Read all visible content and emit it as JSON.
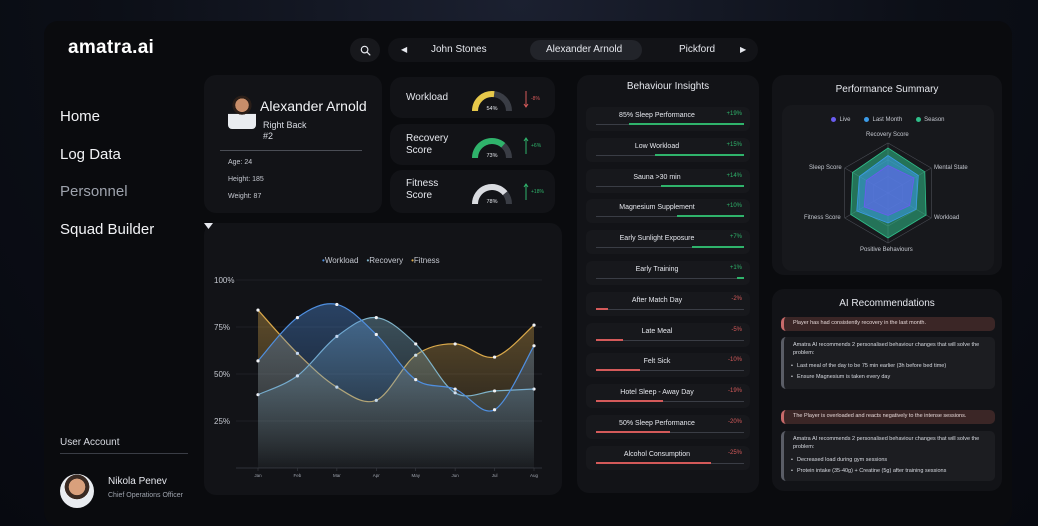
{
  "app": {
    "logo": "amatra.ai"
  },
  "nav": {
    "items": [
      "Home",
      "Log Data",
      "Personnel",
      "Squad Builder"
    ]
  },
  "user": {
    "section_label": "User Account",
    "name": "Nikola Penev",
    "role": "Chief Operations Officer"
  },
  "topbar": {
    "search_icon": "search-icon",
    "players": {
      "prev": "John Stones",
      "current": "Alexander Arnold",
      "next": "Pickford"
    }
  },
  "profile": {
    "name": "Alexander Arnold",
    "position": "Right Back",
    "number": "#2",
    "age": "Age: 24",
    "height": "Height: 185",
    "weight": "Weight: 87"
  },
  "metrics": [
    {
      "label": "Workload",
      "value": "54%",
      "fraction": 0.54,
      "color": "#e6c84a",
      "delta": "-8%",
      "delta_color": "#d45a5a",
      "direction": "down"
    },
    {
      "label": "Recovery Score",
      "value": "73%",
      "fraction": 0.73,
      "color": "#2fb36b",
      "delta": "+6%",
      "delta_color": "#2fb36b",
      "direction": "up"
    },
    {
      "label": "Fitness Score",
      "value": "78%",
      "fraction": 0.78,
      "color": "#d9dbe0",
      "delta": "+18%",
      "delta_color": "#2fb36b",
      "direction": "up"
    }
  ],
  "chart_data": {
    "type": "area",
    "legend": [
      "Workload",
      "Recovery",
      "Fitness"
    ],
    "categories": [
      "Jan",
      "Feb",
      "Mar",
      "Apr",
      "May",
      "Jun",
      "Jul",
      "Aug"
    ],
    "y_ticks": [
      "100%",
      "75%",
      "50%",
      "25%"
    ],
    "ylim": [
      0,
      100
    ],
    "series": [
      {
        "name": "Workload",
        "color": "#4f8fe0",
        "values": [
          57,
          80,
          87,
          71,
          47,
          42,
          31,
          65
        ]
      },
      {
        "name": "Recovery",
        "color": "#7fb3c9",
        "values": [
          39,
          49,
          70,
          80,
          66,
          40,
          41,
          42
        ]
      },
      {
        "name": "Fitness",
        "color": "#d9a84a",
        "values": [
          84,
          61,
          43,
          36,
          60,
          66,
          59,
          76
        ]
      }
    ]
  },
  "behaviour": {
    "title": "Behaviour Insights",
    "items": [
      {
        "label": "85% Sleep Performance",
        "value": "+19%",
        "fill": 0.78,
        "positive": true
      },
      {
        "label": "Low Workload",
        "value": "+15%",
        "fill": 0.6,
        "positive": true
      },
      {
        "label": "Sauna >30 min",
        "value": "+14%",
        "fill": 0.56,
        "positive": true
      },
      {
        "label": "Magnesium Supplement",
        "value": "+10%",
        "fill": 0.45,
        "positive": true
      },
      {
        "label": "Early Sunlight Exposure",
        "value": "+7%",
        "fill": 0.35,
        "positive": true
      },
      {
        "label": "Early Training",
        "value": "+1%",
        "fill": 0.05,
        "positive": true
      },
      {
        "label": "After Match Day",
        "value": "-2%",
        "fill": 0.08,
        "positive": false
      },
      {
        "label": "Late Meal",
        "value": "-5%",
        "fill": 0.18,
        "positive": false
      },
      {
        "label": "Felt Sick",
        "value": "-10%",
        "fill": 0.3,
        "positive": false
      },
      {
        "label": "Hotel Sleep - Away Day",
        "value": "-19%",
        "fill": 0.45,
        "positive": false
      },
      {
        "label": "50% Sleep Performance",
        "value": "-20%",
        "fill": 0.5,
        "positive": false
      },
      {
        "label": "Alcohol Consumption",
        "value": "-25%",
        "fill": 0.78,
        "positive": false
      }
    ],
    "positive_color": "#2fb36b",
    "negative_color": "#d45a5a"
  },
  "performance": {
    "title": "Performance Summary",
    "legend": [
      {
        "label": "Live",
        "color": "#6a5cf0"
      },
      {
        "label": "Last Month",
        "color": "#3b9be8"
      },
      {
        "label": "Season",
        "color": "#2fbf8a"
      }
    ],
    "axes": [
      "Recovery Score",
      "Mental State",
      "Workload",
      "Positive Behaviours",
      "Fitness Score",
      "Sleep Score"
    ],
    "series": [
      {
        "name": "Live",
        "values": [
          0.55,
          0.6,
          0.5,
          0.45,
          0.55,
          0.5
        ]
      },
      {
        "name": "Last Month",
        "values": [
          0.75,
          0.7,
          0.65,
          0.6,
          0.72,
          0.66
        ]
      },
      {
        "name": "Season",
        "values": [
          0.9,
          0.85,
          0.88,
          0.9,
          0.86,
          0.82
        ]
      }
    ]
  },
  "ai": {
    "title": "AI Recommendations",
    "alert1": "Player has had consistently recovery in the last month.",
    "box1_intro": "Amatra AI recommends 2 personalised behaviour changes that will solve the problem:",
    "box1_bullets": [
      "Last meal of the day to be 75 min earlier (3h before bed time)",
      "Ensure Magnesium is taken every day"
    ],
    "alert2": "The Player is overloaded and reacts negatively to the intense sessions.",
    "box2_intro": "Amatra AI recommends 2 personalised behaviour changes that will solve the problem:",
    "box2_bullets": [
      "Decreased load during gym sessions",
      "Protein intake (35-40g) + Creatine (5g) after training sessions"
    ]
  }
}
